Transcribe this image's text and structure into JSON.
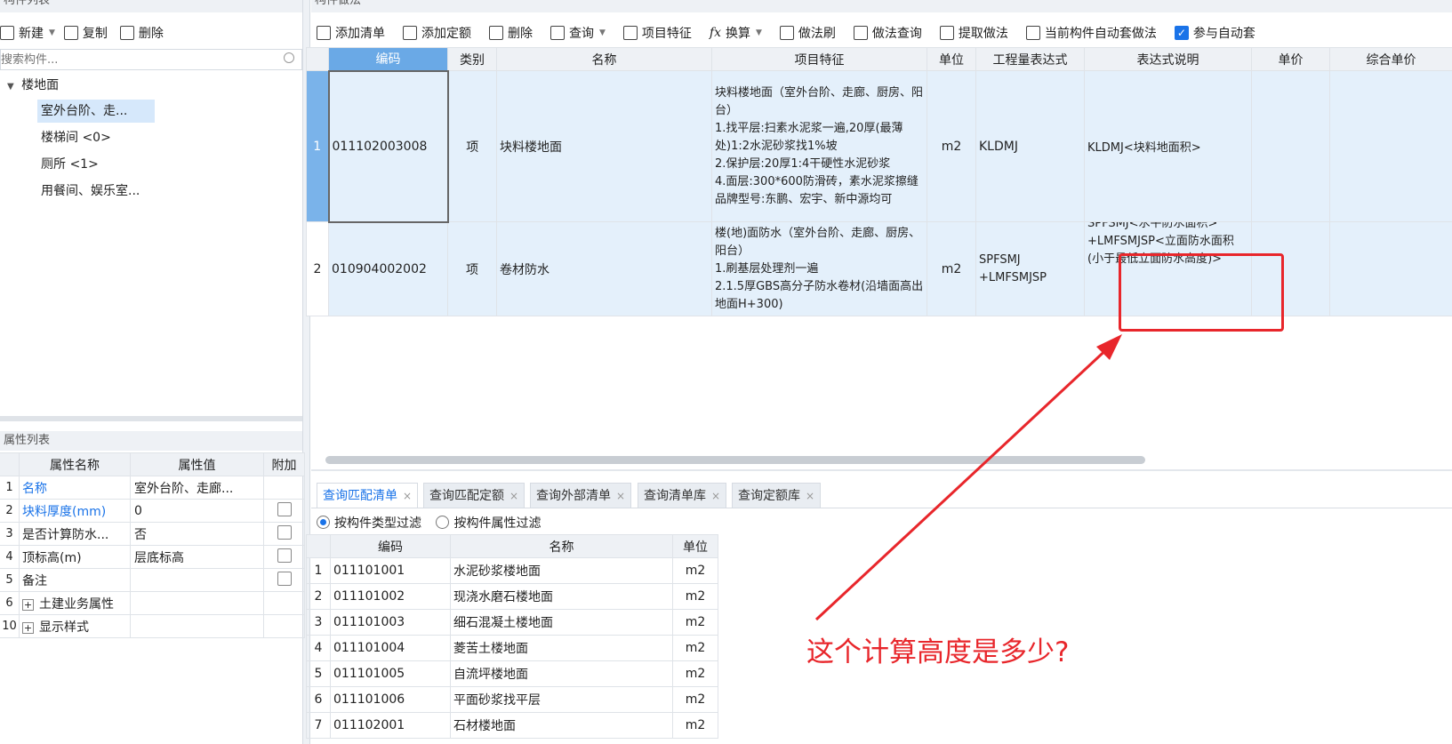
{
  "left_panel": {
    "title": "构件列表",
    "toolbar": {
      "new": "新建",
      "copy": "复制",
      "delete": "删除"
    },
    "search_placeholder": "搜索构件...",
    "tree": {
      "root": "楼地面",
      "items": [
        "室外台阶、走...",
        "楼梯间 <0>",
        "厕所 <1>",
        "用餐间、娱乐室..."
      ],
      "selected_index": 0
    }
  },
  "props_panel": {
    "title": "属性列表",
    "headers": [
      "属性名称",
      "属性值",
      "附加"
    ],
    "rows": [
      {
        "num": "1",
        "name": "名称",
        "value": "室外台阶、走廊...",
        "blue": true,
        "check": false
      },
      {
        "num": "2",
        "name": "块料厚度(mm)",
        "value": "0",
        "blue": true,
        "check": true
      },
      {
        "num": "3",
        "name": "是否计算防水...",
        "value": "否",
        "blue": false,
        "check": true
      },
      {
        "num": "4",
        "name": "顶标高(m)",
        "value": "层底标高",
        "blue": false,
        "check": true
      },
      {
        "num": "5",
        "name": "备注",
        "value": "",
        "blue": false,
        "check": true
      },
      {
        "num": "6",
        "name": "土建业务属性",
        "value": "",
        "blue": false,
        "expand": true,
        "check": false
      },
      {
        "num": "10",
        "name": "显示样式",
        "value": "",
        "blue": false,
        "expand": true,
        "check": false
      }
    ]
  },
  "main_panel": {
    "title": "构件做法",
    "toolbar": {
      "add_list": "添加清单",
      "add_quota": "添加定额",
      "delete": "删除",
      "query": "查询",
      "item_feature": "项目特征",
      "convert": "换算",
      "method_brush": "做法刷",
      "method_query": "做法查询",
      "extract_method": "提取做法",
      "auto_method": "当前构件自动套做法",
      "participate_auto": "参与自动套"
    },
    "table": {
      "headers": [
        "编码",
        "类别",
        "名称",
        "项目特征",
        "单位",
        "工程量表达式",
        "表达式说明",
        "单价",
        "综合单价"
      ],
      "rows": [
        {
          "num": "1",
          "code": "011102003008",
          "type": "项",
          "name": "块料楼地面",
          "feature": "块料楼地面（室外台阶、走廊、厨房、阳台）\n1.找平层:扫素水泥浆一遍,20厚(最薄处)1:2水泥砂浆找1%坡\n2.保护层:20厚1:4干硬性水泥砂浆\n4.面层:300*600防滑砖，素水泥浆擦缝 品牌型号:东鹏、宏宇、新中源均可",
          "unit": "m2",
          "expr": "KLDMJ",
          "expr_desc": "KLDMJ<块料地面积>"
        },
        {
          "num": "2",
          "code": "010904002002",
          "type": "项",
          "name": "卷材防水",
          "feature": "楼(地)面防水（室外台阶、走廊、厨房、阳台）\n1.刷基层处理剂一遍\n2.1.5厚GBS高分子防水卷材(沿墙面高出地面H+300)",
          "unit": "m2",
          "expr": "SPFSMJ\n+LMFSMJSP",
          "expr_desc_top": "SPFSMJ<水平防水面积>",
          "expr_desc": "+LMFSMJSP<立面防水面积(小于最低立面防水高度)>"
        }
      ]
    }
  },
  "bottom_panel": {
    "tabs": [
      "查询匹配清单",
      "查询匹配定额",
      "查询外部清单",
      "查询清单库",
      "查询定额库"
    ],
    "active_tab": 0,
    "filter_type": "按构件类型过滤",
    "filter_attr": "按构件属性过滤",
    "headers": [
      "编码",
      "名称",
      "单位"
    ],
    "rows": [
      {
        "num": "1",
        "code": "011101001",
        "name": "水泥砂浆楼地面",
        "unit": "m2"
      },
      {
        "num": "2",
        "code": "011101002",
        "name": "现浇水磨石楼地面",
        "unit": "m2"
      },
      {
        "num": "3",
        "code": "011101003",
        "name": "细石混凝土楼地面",
        "unit": "m2"
      },
      {
        "num": "4",
        "code": "011101004",
        "name": "菱苦土楼地面",
        "unit": "m2"
      },
      {
        "num": "5",
        "code": "011101005",
        "name": "自流坪楼地面",
        "unit": "m2"
      },
      {
        "num": "6",
        "code": "011101006",
        "name": "平面砂浆找平层",
        "unit": "m2"
      },
      {
        "num": "7",
        "code": "011102001",
        "name": "石材楼地面",
        "unit": "m2"
      }
    ]
  },
  "annotation": {
    "question": "这个计算高度是多少?",
    "color": "#e8262b"
  },
  "colors": {
    "accent": "#1a73e8",
    "selected_row": "#e4f0fb",
    "selected_num": "#7ab3ea",
    "header_selected": "#6aa9e6"
  }
}
